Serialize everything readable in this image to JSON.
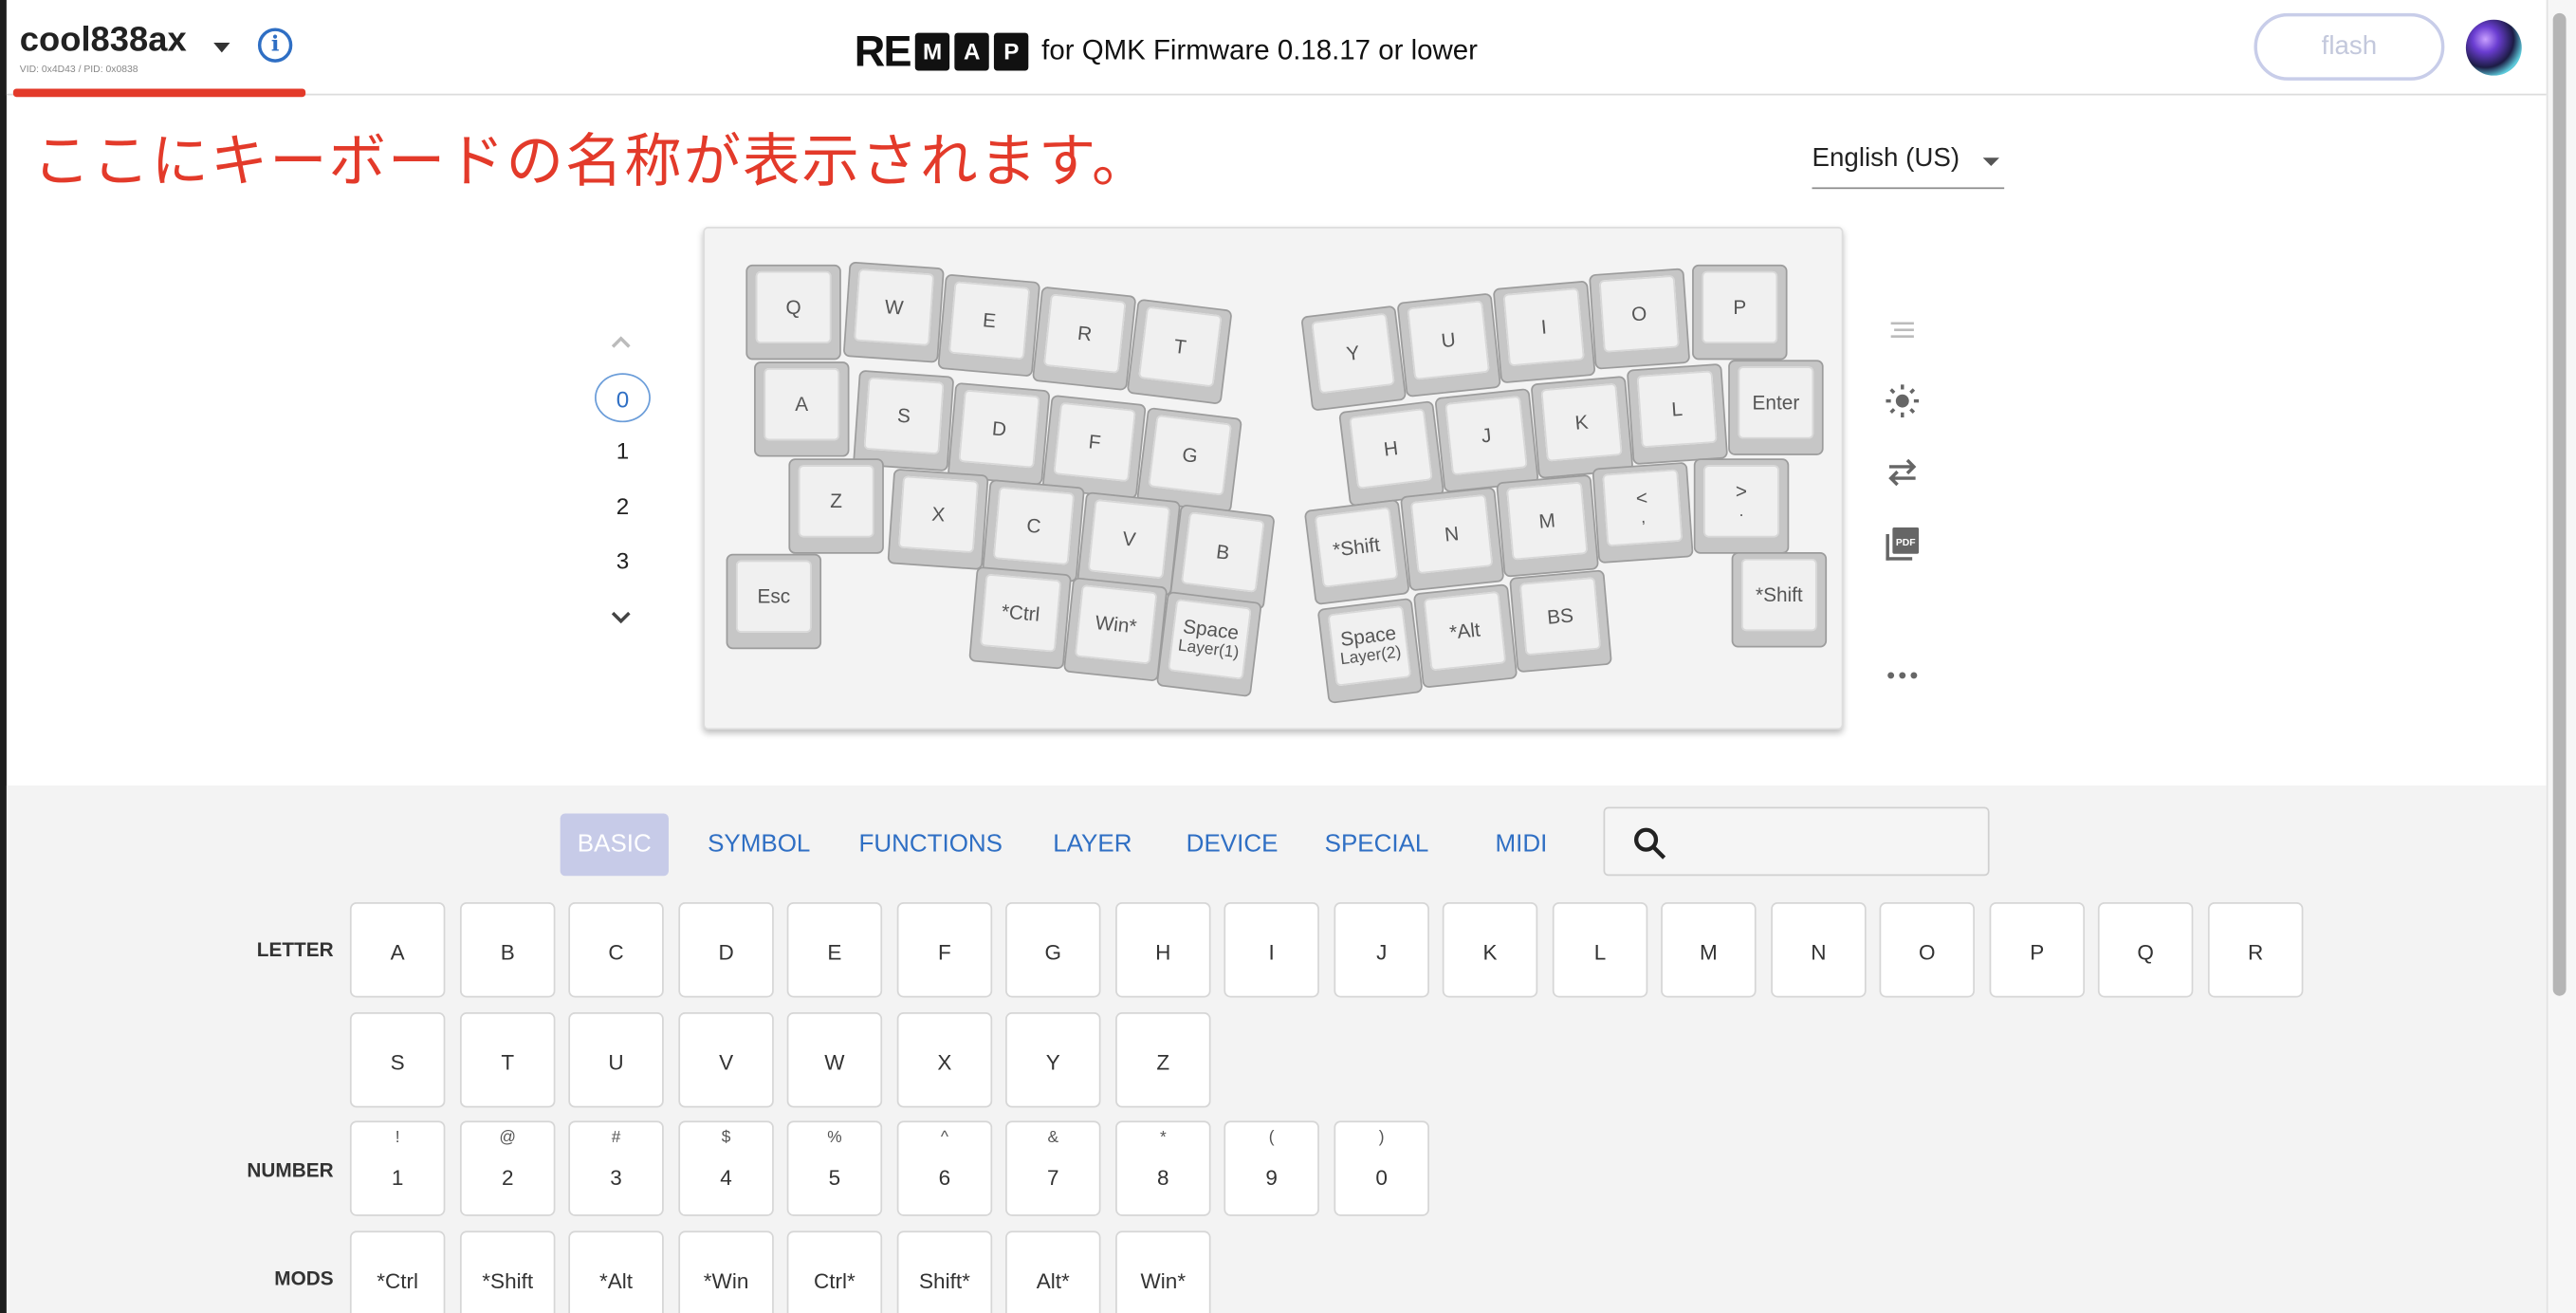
{
  "header": {
    "keyboard_name": "cool838ax",
    "vid_pid": "VID: 0x4D43 / PID: 0x0838",
    "logo_re": "RE",
    "logo_letters": [
      "M",
      "A",
      "P"
    ],
    "logo_subtitle": "for QMK Firmware 0.18.17 or lower",
    "flash_label": "flash",
    "icons": {
      "dropdown": "caret-down-icon",
      "info": "info-icon",
      "avatar": "user-avatar"
    }
  },
  "annotation": "ここにキーボードの名称が表示されます。",
  "language": {
    "selected": "English (US)"
  },
  "layers": {
    "items": [
      "0",
      "1",
      "2",
      "3"
    ],
    "selected": "0"
  },
  "keymap": {
    "keys": [
      {
        "label": "Q"
      },
      {
        "label": "W"
      },
      {
        "label": "E"
      },
      {
        "label": "R"
      },
      {
        "label": "T"
      },
      {
        "label": "A"
      },
      {
        "label": "S"
      },
      {
        "label": "D"
      },
      {
        "label": "F"
      },
      {
        "label": "G"
      },
      {
        "label": "Z"
      },
      {
        "label": "X"
      },
      {
        "label": "C"
      },
      {
        "label": "V"
      },
      {
        "label": "B"
      },
      {
        "label": "Esc"
      },
      {
        "label": "*Ctrl"
      },
      {
        "label": "Win*"
      },
      {
        "label": "Space",
        "sub": "Layer(1)"
      },
      {
        "label": "Y"
      },
      {
        "label": "U"
      },
      {
        "label": "I"
      },
      {
        "label": "O"
      },
      {
        "label": "P"
      },
      {
        "label": "H"
      },
      {
        "label": "J"
      },
      {
        "label": "K"
      },
      {
        "label": "L"
      },
      {
        "label": "Enter"
      },
      {
        "label": "*Shift"
      },
      {
        "label": "N"
      },
      {
        "label": "M"
      },
      {
        "label": "<",
        "sub": ","
      },
      {
        "label": ">",
        "sub": "."
      },
      {
        "label": "Space",
        "sub": "Layer(2)"
      },
      {
        "label": "*Alt"
      },
      {
        "label": "BS"
      },
      {
        "label": "*Shift"
      }
    ]
  },
  "side_tools": [
    "text-lines-icon",
    "brightness-icon",
    "swap-arrows-icon",
    "pdf-icon",
    "more-icon"
  ],
  "palette": {
    "tabs": [
      "BASIC",
      "SYMBOL",
      "FUNCTIONS",
      "LAYER",
      "DEVICE",
      "SPECIAL",
      "MIDI"
    ],
    "selected_tab": "BASIC",
    "search_placeholder": "",
    "rows": {
      "letter_label": "LETTER",
      "letters": [
        "A",
        "B",
        "C",
        "D",
        "E",
        "F",
        "G",
        "H",
        "I",
        "J",
        "K",
        "L",
        "M",
        "N",
        "O",
        "P",
        "Q",
        "R",
        "S",
        "T",
        "U",
        "V",
        "W",
        "X",
        "Y",
        "Z"
      ],
      "number_label": "NUMBER",
      "numbers": [
        {
          "shift": "!",
          "main": "1"
        },
        {
          "shift": "@",
          "main": "2"
        },
        {
          "shift": "#",
          "main": "3"
        },
        {
          "shift": "$",
          "main": "4"
        },
        {
          "shift": "%",
          "main": "5"
        },
        {
          "shift": "^",
          "main": "6"
        },
        {
          "shift": "&",
          "main": "7"
        },
        {
          "shift": "*",
          "main": "8"
        },
        {
          "shift": "(",
          "main": "9"
        },
        {
          "shift": ")",
          "main": "0"
        }
      ],
      "mods_label": "MODS",
      "mods": [
        "*Ctrl",
        "*Shift",
        "*Alt",
        "*Win",
        "Ctrl*",
        "Shift*",
        "Alt*",
        "Win*"
      ]
    }
  },
  "colors": {
    "accent": "#2f6fc4",
    "annotation": "#e33a2a",
    "tab_selected_bg": "#c7cbe8"
  }
}
